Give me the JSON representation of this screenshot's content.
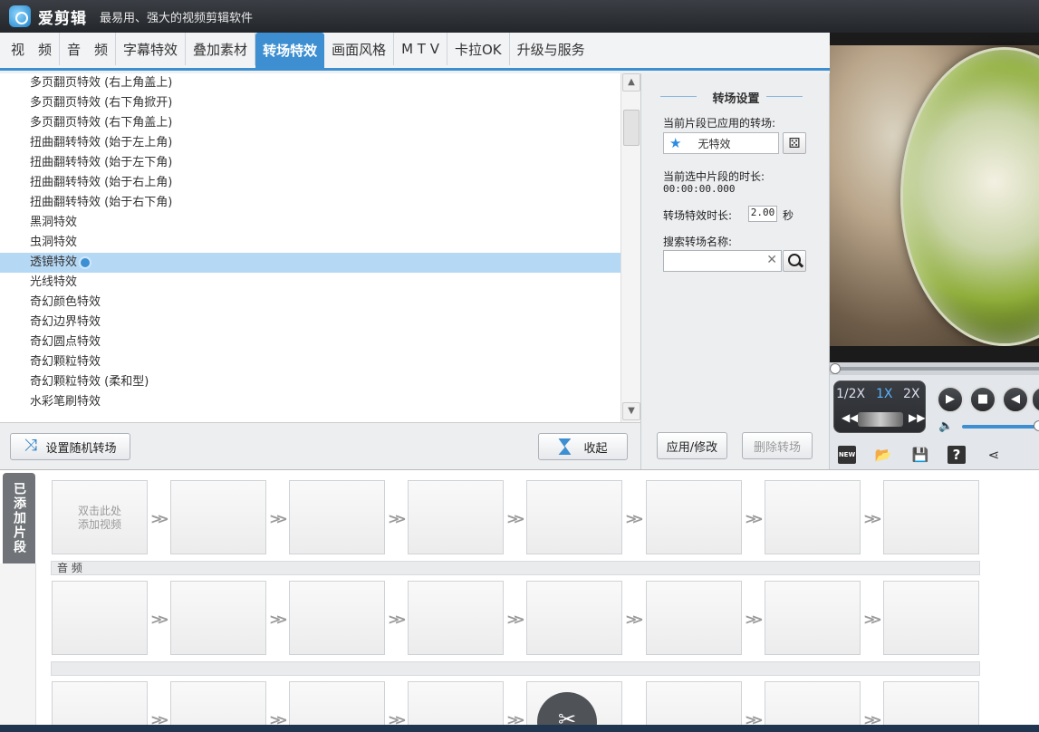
{
  "app": {
    "name": "爱剪辑",
    "slogan": "最易用、强大的视频剪辑软件"
  },
  "tabs": [
    {
      "label": "视　频",
      "active": false
    },
    {
      "label": "音　频",
      "active": false
    },
    {
      "label": "字幕特效",
      "active": false
    },
    {
      "label": "叠加素材",
      "active": false
    },
    {
      "label": "转场特效",
      "active": true
    },
    {
      "label": "画面风格",
      "active": false
    },
    {
      "label": "M T V",
      "active": false
    },
    {
      "label": "卡拉OK",
      "active": false
    },
    {
      "label": "升级与服务",
      "active": false
    }
  ],
  "effects": [
    "多页翻页特效 (右上角盖上)",
    "多页翻页特效 (右下角掀开)",
    "多页翻页特效 (右下角盖上)",
    "扭曲翻转特效 (始于左上角)",
    "扭曲翻转特效 (始于左下角)",
    "扭曲翻转特效 (始于右上角)",
    "扭曲翻转特效 (始于右下角)",
    "黑洞特效",
    "虫洞特效",
    "透镜特效",
    "光线特效",
    "奇幻颜色特效",
    "奇幻边界特效",
    "奇幻圆点特效",
    "奇幻颗粒特效",
    "奇幻颗粒特效 (柔和型)",
    "水彩笔刷特效"
  ],
  "selected_effect_index": 9,
  "list_footer": {
    "random_button": "设置随机转场",
    "collapse_button": "收起"
  },
  "settings": {
    "title": "转场设置",
    "applied_label": "当前片段已应用的转场:",
    "applied_value": "无特效",
    "duration_label": "当前选中片段的时长:",
    "duration_value": "00:00:00.000",
    "effect_duration_label": "转场特效时长:",
    "effect_duration_value": "2.00",
    "effect_duration_unit": "秒",
    "search_label": "搜索转场名称:",
    "search_placeholder": "",
    "apply_button": "应用/修改",
    "delete_button": "删除转场"
  },
  "player": {
    "speed_options": [
      "1/2X",
      "1X",
      "2X"
    ],
    "active_speed": "1X",
    "progress": 0
  },
  "clips": {
    "side_label": "已添加片段",
    "add_hint_line1": "双击此处",
    "add_hint_line2": "添加视频",
    "audio_row_label": "音 频"
  },
  "colors": {
    "accent": "#3d8fd1",
    "selection": "#b5d8f5",
    "titlebar": "#2a2d31"
  }
}
